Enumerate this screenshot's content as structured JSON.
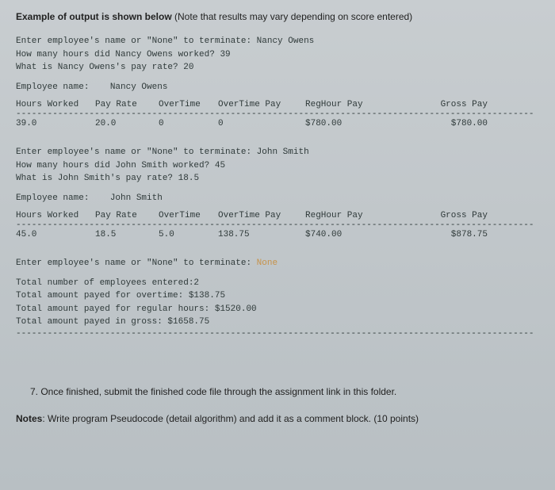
{
  "heading": {
    "bold": "Example of output is shown below",
    "rest": " (Note that results may vary depending on score entered)"
  },
  "emp1": {
    "prompt_name": "Enter employee's name or \"None\" to terminate: ",
    "name_input": "Nancy Owens",
    "prompt_hours": "How many hours did Nancy Owens worked? ",
    "hours_input": "39",
    "prompt_rate": "What is Nancy Owens's pay rate? ",
    "rate_input": "20",
    "label_empname": "Employee name:    ",
    "empname_val": "Nancy Owens",
    "headers": {
      "hours": "Hours Worked",
      "rate": "Pay Rate",
      "ot": "OverTime",
      "otpay": "OverTime Pay",
      "regpay": "RegHour Pay",
      "gross": "Gross Pay"
    },
    "values": {
      "hours": "39.0",
      "rate": "20.0",
      "ot": "0",
      "otpay": "0",
      "regpay": "$780.00",
      "gross": "$780.00"
    }
  },
  "emp2": {
    "prompt_name": "Enter employee's name or \"None\" to terminate: ",
    "name_input": "John Smith",
    "prompt_hours": "How many hours did John Smith worked? ",
    "hours_input": "45",
    "prompt_rate": "What is John Smith's pay rate? ",
    "rate_input": "18.5",
    "label_empname": "Employee name:    ",
    "empname_val": "John Smith",
    "headers": {
      "hours": "Hours Worked",
      "rate": "Pay Rate",
      "ot": "OverTime",
      "otpay": "OverTime Pay",
      "regpay": "RegHour Pay",
      "gross": "Gross Pay"
    },
    "values": {
      "hours": "45.0",
      "rate": "18.5",
      "ot": "5.0",
      "otpay": "138.75",
      "regpay": "$740.00",
      "gross": "$878.75"
    }
  },
  "final": {
    "prompt_name": "Enter employee's name or \"None\" to terminate: ",
    "none_input": "None"
  },
  "totals": {
    "line1": "Total number of employees entered:2",
    "line2": "Total amount payed for overtime: $138.75",
    "line3": "Total amount payed for regular hours: $1520.00",
    "line4": "Total amount payed in gross: $1658.75"
  },
  "dash": "---------------------------------------------------------------------------------------------------",
  "footer": "7. Once finished, submit the finished code file through the assignment link in this folder.",
  "notes": {
    "bold": "Notes",
    "rest": ": Write program Pseudocode (detail algorithm) and add it as a comment block. (10 points)"
  }
}
